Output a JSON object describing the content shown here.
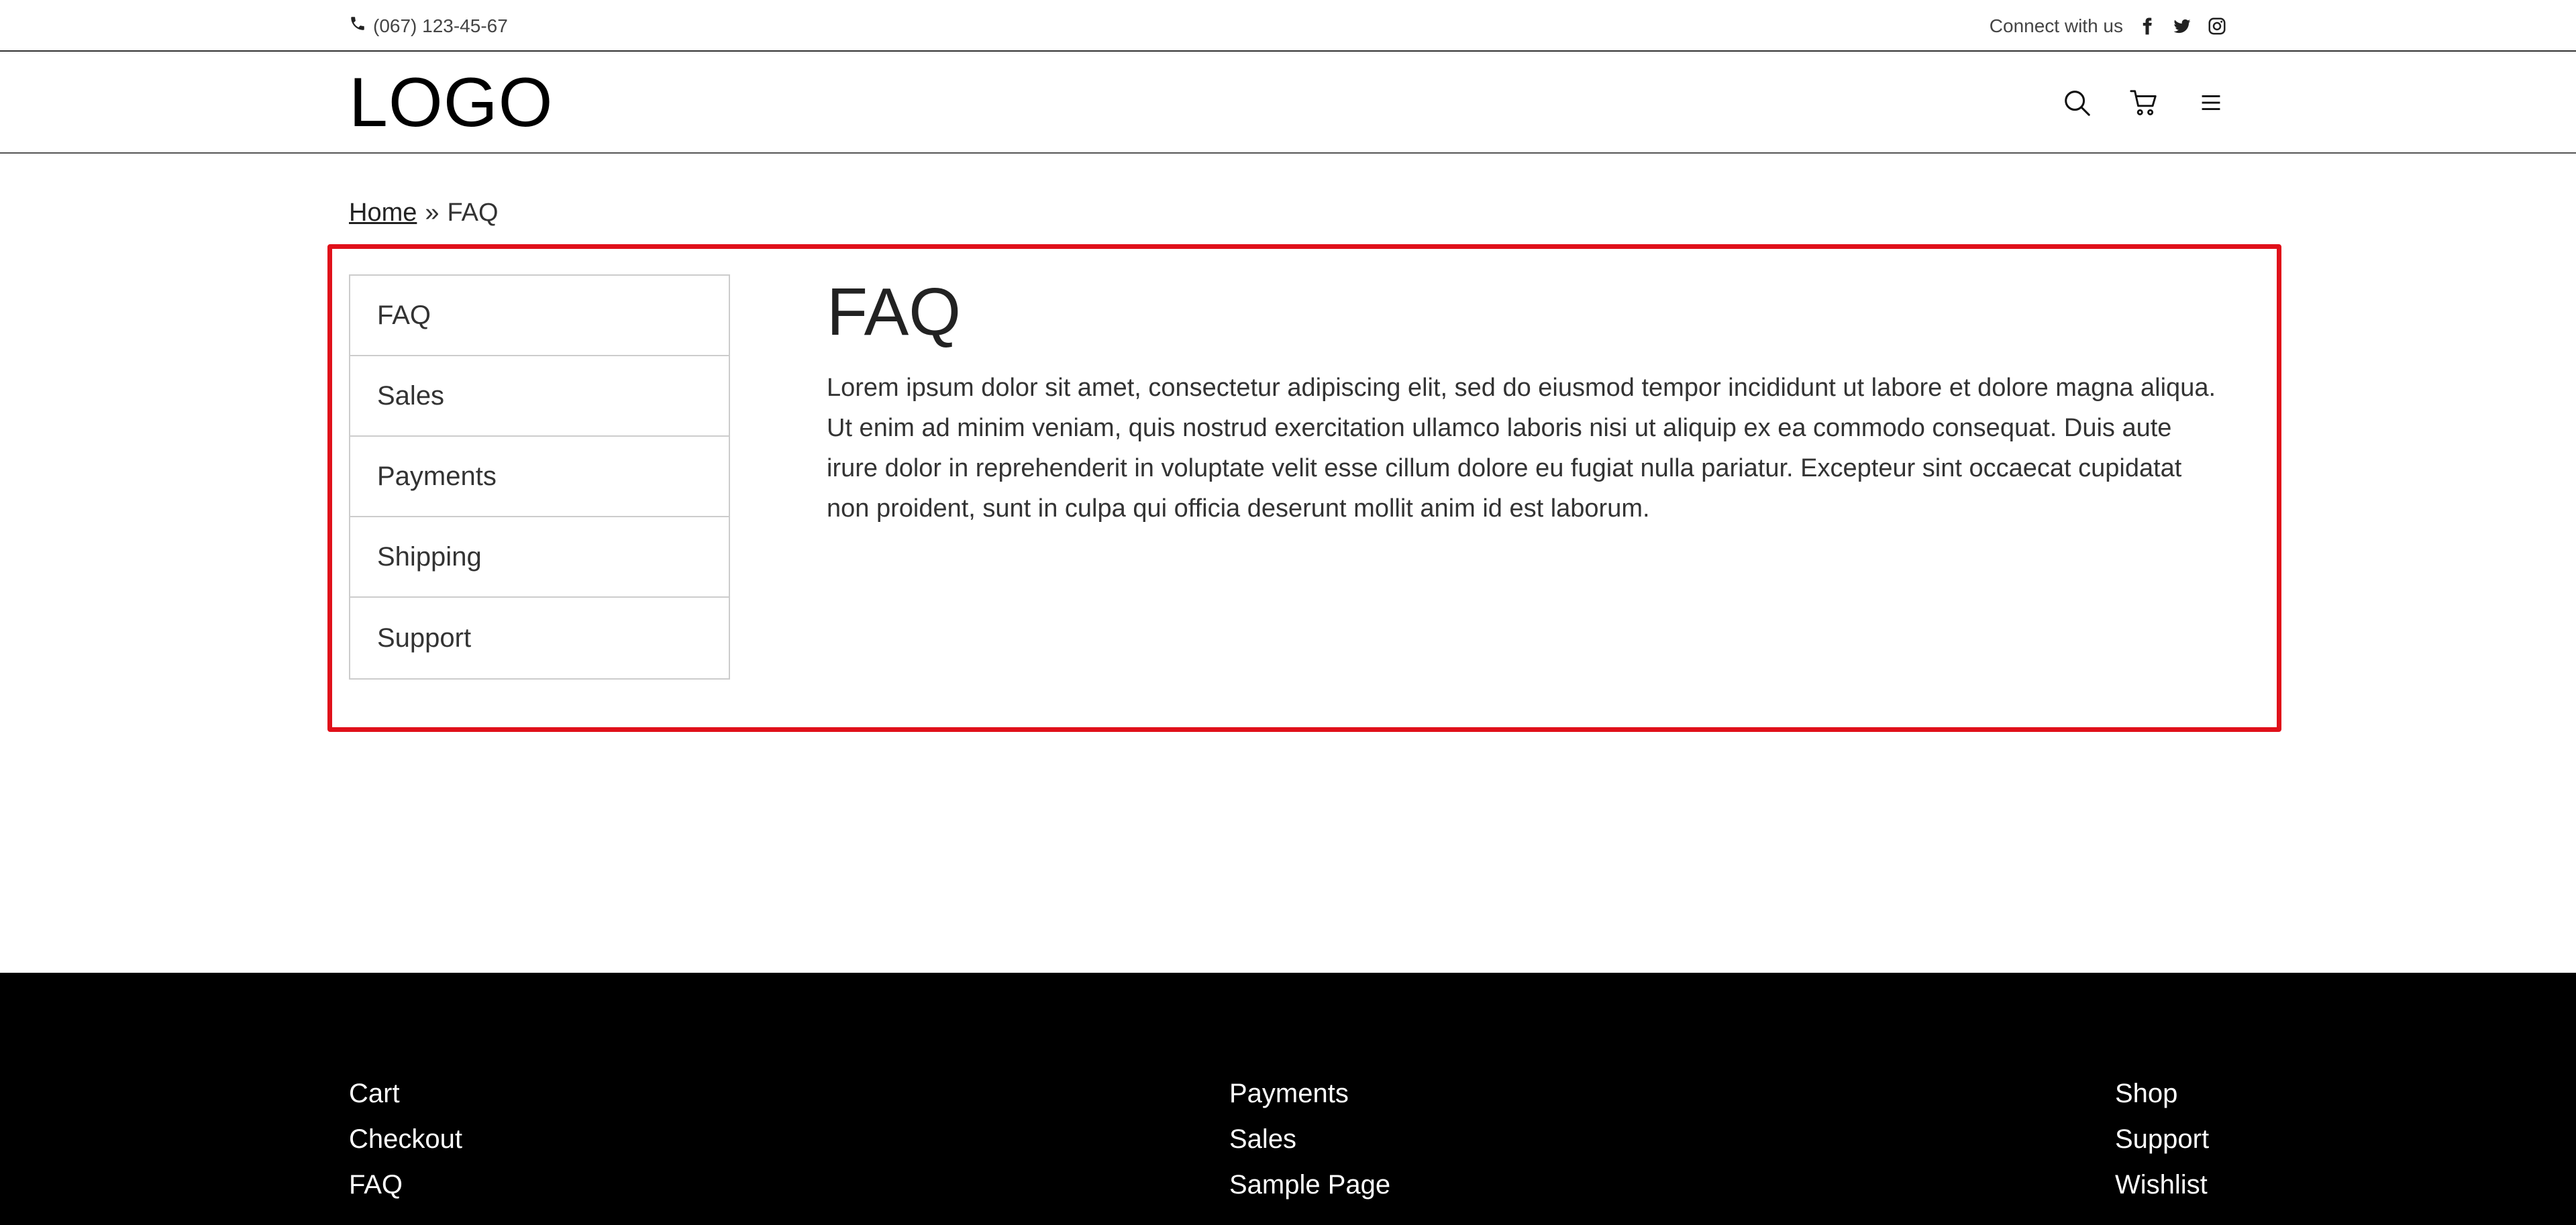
{
  "topbar": {
    "phone": "(067) 123-45-67",
    "connect_label": "Connect with us",
    "social": [
      {
        "icon": "facebook-icon"
      },
      {
        "icon": "twitter-icon"
      },
      {
        "icon": "instagram-icon"
      }
    ]
  },
  "header": {
    "logo": "LOGO",
    "icons": [
      "search-icon",
      "cart-icon",
      "menu-icon"
    ]
  },
  "breadcrumb": {
    "home": "Home",
    "separator": "»",
    "current": "FAQ"
  },
  "sidebar": {
    "items": [
      {
        "label": "FAQ"
      },
      {
        "label": "Sales"
      },
      {
        "label": "Payments"
      },
      {
        "label": "Shipping"
      },
      {
        "label": "Support"
      }
    ]
  },
  "content": {
    "title": "FAQ",
    "body": "Lorem ipsum dolor sit amet, consectetur adipiscing elit, sed do eiusmod tempor incididunt ut labore et dolore magna aliqua. Ut enim ad minim veniam, quis nostrud exercitation ullamco laboris nisi ut aliquip ex ea commodo consequat. Duis aute irure dolor in reprehenderit in voluptate velit esse cillum dolore eu fugiat nulla pariatur. Excepteur sint occaecat cupidatat non proident, sunt in culpa qui officia deserunt mollit anim id est laborum."
  },
  "footer": {
    "col1": [
      "Cart",
      "Checkout",
      "FAQ"
    ],
    "col2": [
      "Payments",
      "Sales",
      "Sample Page"
    ],
    "col3": [
      "Shop",
      "Support",
      "Wishlist"
    ]
  },
  "colors": {
    "highlight": "#e0101a",
    "footer_bg": "#000000"
  }
}
